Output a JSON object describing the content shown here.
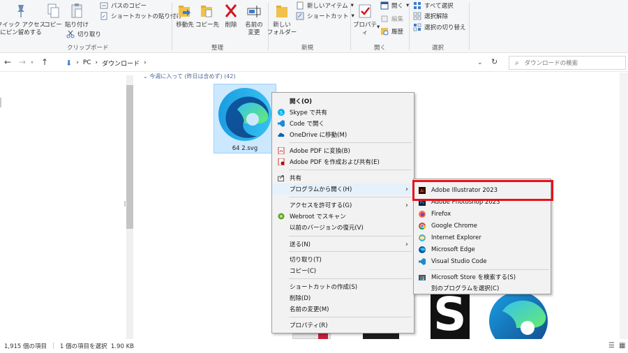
{
  "ribbon": {
    "clipboard": {
      "quick_access": "クイック アクセス\nにピン留めする",
      "copy": "コピー",
      "paste": "貼り付け",
      "copy_path": "パスのコピー",
      "paste_shortcut": "ショートカットの貼り付け",
      "cut": "切り取り",
      "label": "クリップボード"
    },
    "organize": {
      "move_to": "移動先",
      "copy_to": "コピー先",
      "delete": "削除",
      "rename": "名前の\n変更",
      "label": "整理"
    },
    "new": {
      "new_folder": "新しい\nフォルダー",
      "new_item": "新しいアイテム",
      "shortcut": "ショートカット",
      "label": "新規"
    },
    "open": {
      "properties": "プロパティ",
      "open": "開く",
      "edit": "編集",
      "history": "履歴",
      "label": "開く"
    },
    "select": {
      "select_all": "すべて選択",
      "select_none": "選択解除",
      "invert": "選択の切り替え",
      "label": "選択"
    }
  },
  "address": {
    "path": [
      "PC",
      "ダウンロード"
    ],
    "search_placeholder": "ダウンロードの検索"
  },
  "content": {
    "group_header": "今週に入って (昨日は含めず) (42)",
    "file_name": "64 2.svg"
  },
  "context_menu": {
    "items": [
      {
        "label": "開く(O)",
        "icon": "none"
      },
      {
        "label": "Skype で共有",
        "icon": "skype-icon"
      },
      {
        "label": "Code で開く",
        "icon": "vscode-icon"
      },
      {
        "label": "OneDrive に移動(M)",
        "icon": "onedrive-icon"
      },
      {
        "label": "Adobe PDF に変換(B)",
        "icon": "pdf-icon"
      },
      {
        "label": "Adobe PDF を作成および共有(E)",
        "icon": "pdf-share-icon"
      },
      {
        "label": "共有",
        "icon": "share-icon"
      },
      {
        "label": "プログラムから開く(H)",
        "icon": "none"
      },
      {
        "label": "アクセスを許可する(G)",
        "icon": "none"
      },
      {
        "label": "Webroot でスキャン",
        "icon": "webroot-icon"
      },
      {
        "label": "以前のバージョンの復元(V)",
        "icon": "none"
      },
      {
        "label": "送る(N)",
        "icon": "none"
      },
      {
        "label": "切り取り(T)",
        "icon": "none"
      },
      {
        "label": "コピー(C)",
        "icon": "none"
      },
      {
        "label": "ショートカットの作成(S)",
        "icon": "none"
      },
      {
        "label": "削除(D)",
        "icon": "none"
      },
      {
        "label": "名前の変更(M)",
        "icon": "none"
      },
      {
        "label": "プロパティ(R)",
        "icon": "none"
      }
    ]
  },
  "open_with_menu": {
    "items": [
      {
        "label": "Adobe Illustrator 2023",
        "icon": "illustrator-icon"
      },
      {
        "label": "Adobe Photoshop 2023",
        "icon": "photoshop-icon"
      },
      {
        "label": "Firefox",
        "icon": "firefox-icon"
      },
      {
        "label": "Google Chrome",
        "icon": "chrome-icon"
      },
      {
        "label": "Internet Explorer",
        "icon": "ie-icon"
      },
      {
        "label": "Microsoft Edge",
        "icon": "edge-icon"
      },
      {
        "label": "Visual Studio Code",
        "icon": "vscode-icon"
      },
      {
        "label": "Microsoft Store を検索する(S)",
        "icon": "store-icon"
      },
      {
        "label": "別のプログラムを選択(C)",
        "icon": "none"
      }
    ]
  },
  "status": {
    "item_count": "1,915 個の項目",
    "selection": "1 個の項目を選択  1.90 KB"
  },
  "colors": {
    "highlight_border": "#e8111a",
    "selection_fill": "#cce8ff",
    "menu_bg": "#f2f2f2"
  }
}
